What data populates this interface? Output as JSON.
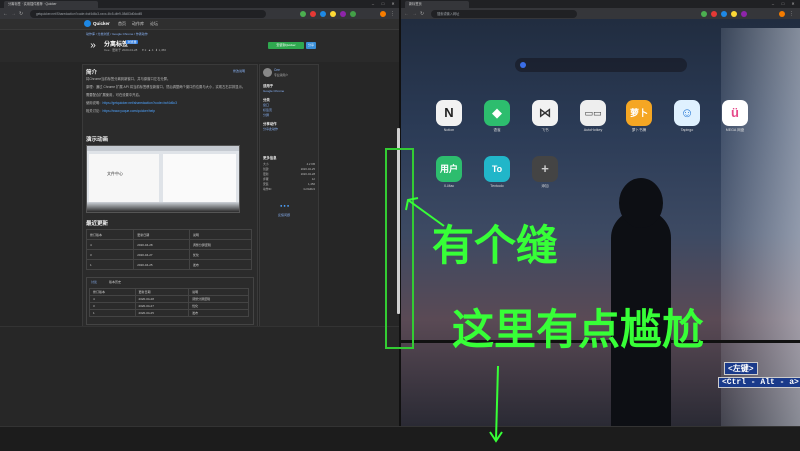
{
  "left_browser": {
    "tab_title": "分离标签 · 实用插件推荐 · Quicker",
    "url": "getquicker.net/Sharedaction?code=bcf4d6c3-xxxx-4fc5-dfe9-08d83d0dcdf8",
    "site": {
      "brand": "Quicker",
      "nav": [
        "首页",
        "动作库",
        "论坛"
      ],
      "breadcrumb": [
        "动作库",
        "分类浏览",
        "Google Chrome",
        "作者动作"
      ]
    },
    "action": {
      "title": "分离标签",
      "badge": "浏览器",
      "meta": "Cee · 更新于 2020-04-28",
      "stats": [
        "2",
        "4",
        "1,456"
      ],
      "install_button": "安装到Quicker",
      "share_button": "分享"
    },
    "intro": {
      "heading": "简介",
      "edit_button": "修改说明",
      "p1": "将Chrome当前标签分离到新窗口，并与原窗口左右分屏。",
      "p2": "原理：通过 Chrome 扩展 API 将当前标签移至新窗口，然后调整两个窗口的位置与大小，实现左右并排显示。",
      "p3": "需要配合扩展使用，可在设置中开启。",
      "p4_label": "使用说明：",
      "p4_link": "https://getquicker.net/sharedaction?code=bcf4d6c3",
      "p5_label": "相关讨论：",
      "p5_link": "https://www.yuque.com/quicker/help"
    },
    "demo_heading": "演示动画",
    "demo_inner": "文件中心",
    "updates": {
      "heading": "最近更新",
      "columns": [
        "修订版本",
        "更新日期",
        "说明"
      ],
      "rows": [
        [
          "4",
          "2020-04-28",
          "调整分屏逻辑"
        ],
        [
          "3",
          "2020-04-27",
          "优化"
        ],
        [
          "1",
          "2020-04-25",
          "发布"
        ]
      ]
    },
    "discussion": {
      "tabs": [
        "讨论",
        "版本历史"
      ],
      "columns": [
        "修订版本",
        "更新日期",
        "说明"
      ],
      "rows": [
        [
          "4",
          "2020-04-28",
          "调整分屏逻辑"
        ],
        [
          "3",
          "2020-04-27",
          "优化"
        ],
        [
          "1",
          "2020-04-25",
          "发布"
        ]
      ]
    },
    "sidebar": {
      "author_name": "Cee",
      "author_role": "专业版用户",
      "section_author": "适用于",
      "app": "Google Chrome",
      "section_category": "分类",
      "tags": [
        "窗口",
        "标签页",
        "分屏"
      ],
      "section_share": "分享动作",
      "share_link": "分享此动作",
      "section_info": "更多信息",
      "info_rows": [
        [
          "大小",
          "4.2 KB"
        ],
        [
          "创建",
          "2020-04-25"
        ],
        [
          "更新",
          "2020-04-28"
        ],
        [
          "步骤",
          "12"
        ],
        [
          "安装",
          "1,456"
        ],
        [
          "动作ID",
          "bcf4d6c3"
        ]
      ],
      "feedback": "反馈问题"
    }
  },
  "right_browser": {
    "tab_title": "新标签页",
    "url": "搜索或输入网址",
    "search_placeholder": "",
    "apps": [
      {
        "label": "Notion",
        "color": "#f2f2f2",
        "glyph": "N",
        "glyph_color": "#222"
      },
      {
        "label": "语雀",
        "color": "#2dbd6e",
        "glyph": "◆",
        "glyph_color": "#fff"
      },
      {
        "label": "飞书",
        "color": "#f2f2f2",
        "glyph": "⋈",
        "glyph_color": "#333"
      },
      {
        "label": "AutoHotkey",
        "color": "#eeeeee",
        "glyph": "▭▭",
        "glyph_color": "#333"
      },
      {
        "label": "萝卜书摘",
        "color": "#f5a623",
        "glyph": "萝卜",
        "glyph_color": "#fff"
      },
      {
        "label": "Tapingo",
        "color": "#dff1ff",
        "glyph": "☺",
        "glyph_color": "#2b7bd6"
      },
      {
        "label": "MEGA 网盘",
        "color": "#ffffff",
        "glyph": "ü",
        "glyph_color": "#e64a8a"
      },
      {
        "label": "X-Mac",
        "color": "#2dbd6e",
        "glyph": "用户",
        "glyph_color": "#fff"
      },
      {
        "label": "Textoolo",
        "color": "#21b6c9",
        "glyph": "To",
        "glyph_color": "#fff"
      },
      {
        "label": "添加",
        "color": "#444444",
        "glyph": "+",
        "glyph_color": "#ccc"
      }
    ]
  },
  "annotations": {
    "gap_text": "有个缝",
    "awkward_text": "这里有点尴尬",
    "key_left": "<左键>",
    "key_combo": "<Ctrl - Alt - a>",
    "accent_color": "#37ff37"
  }
}
